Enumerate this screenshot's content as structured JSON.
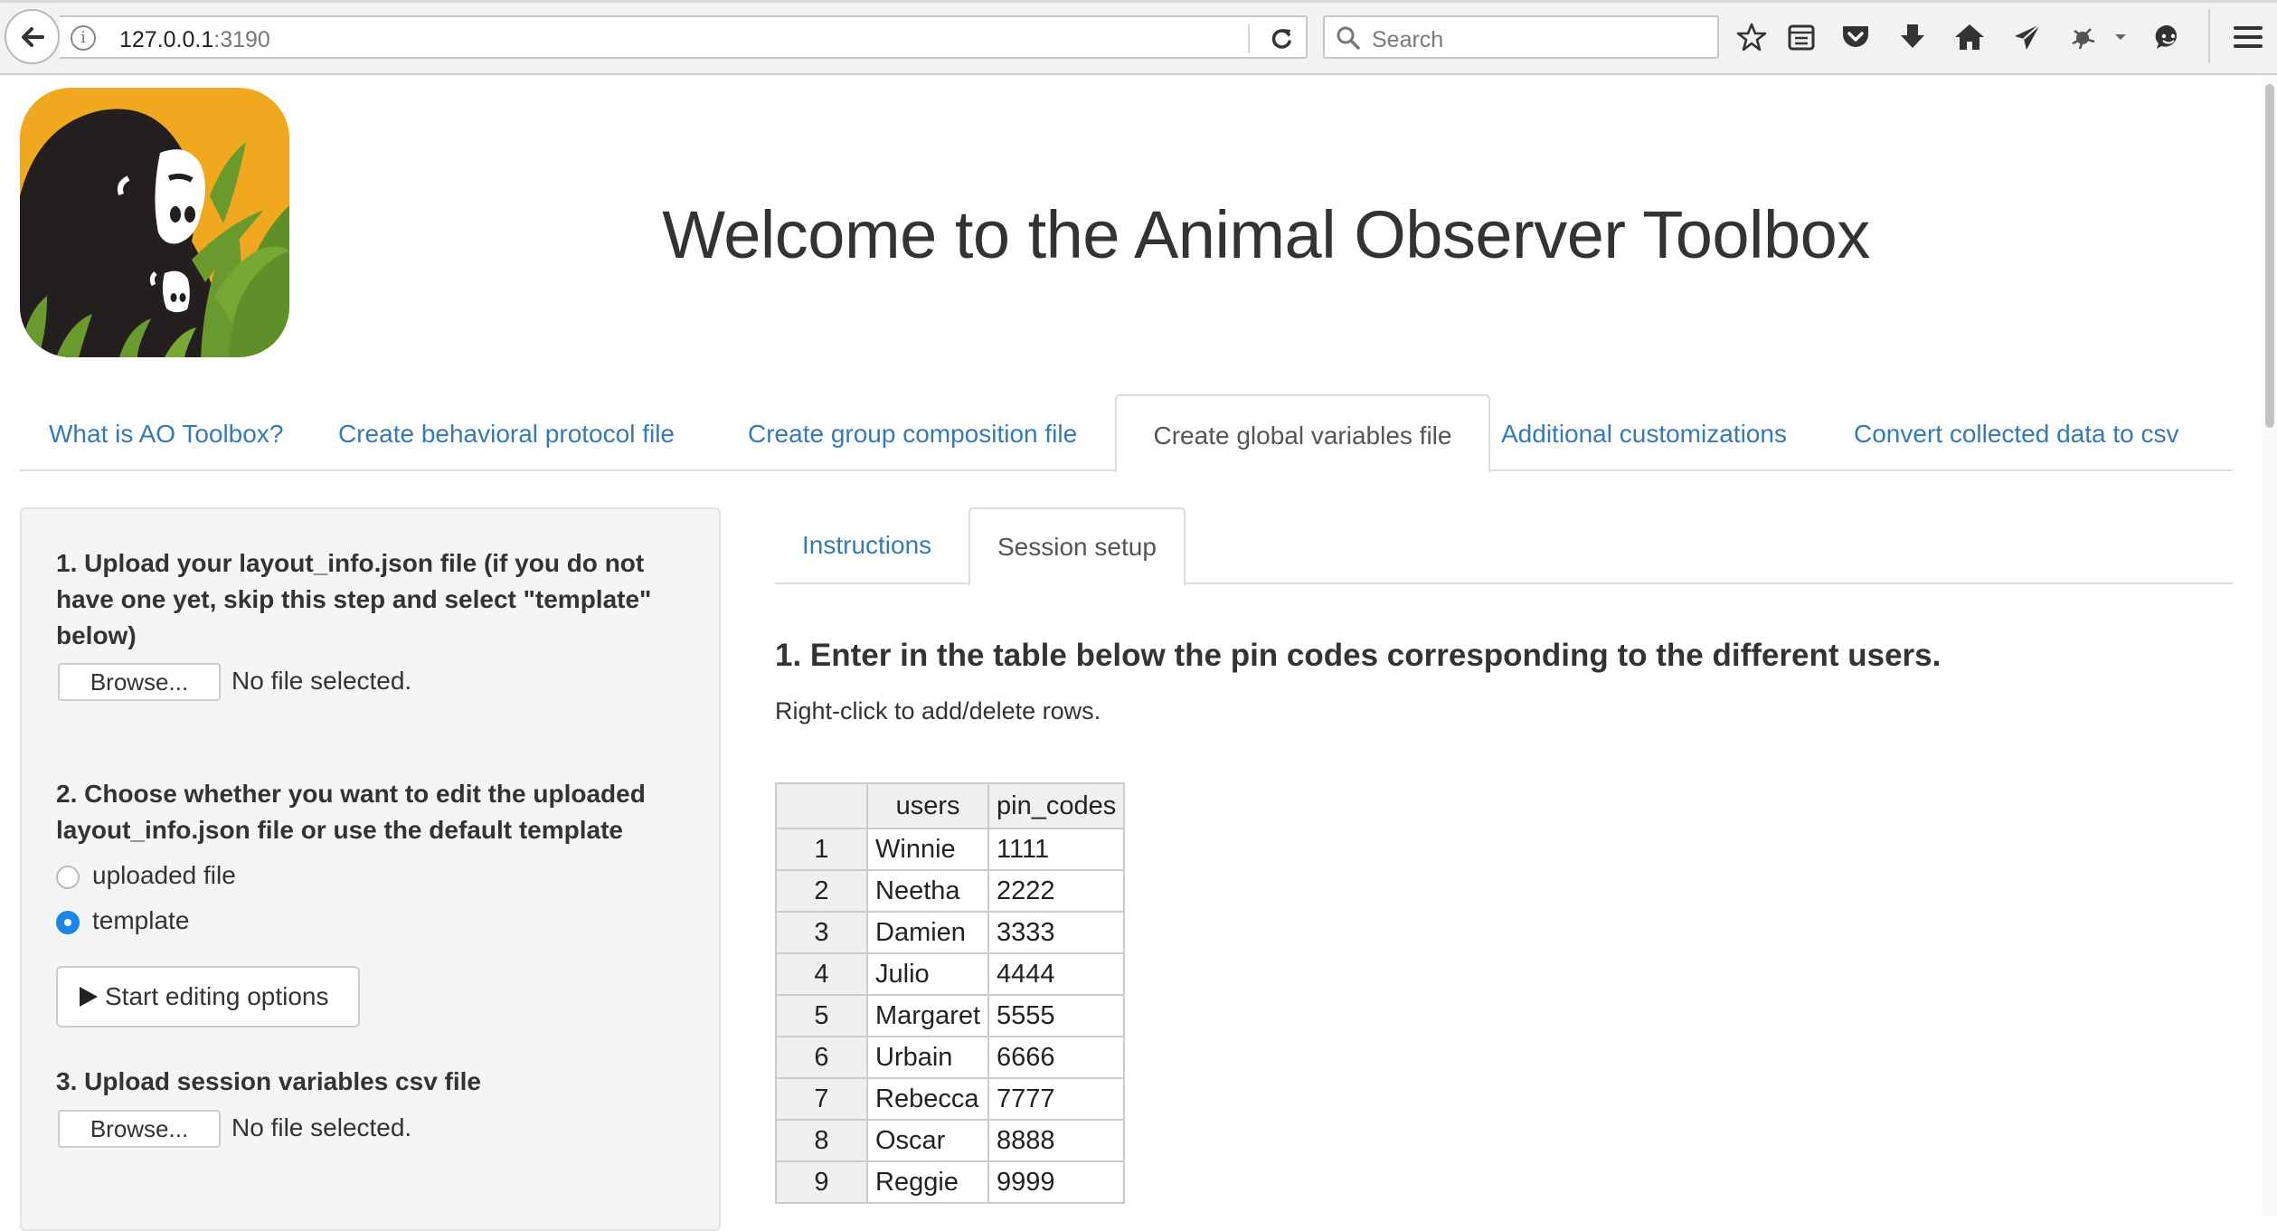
{
  "browser": {
    "url_host": "127.0.0.1",
    "url_port": ":3190",
    "search_placeholder": "Search"
  },
  "header": {
    "title": "Welcome to the Animal Observer Toolbox"
  },
  "main_tabs": [
    {
      "label": "What is AO Toolbox?"
    },
    {
      "label": "Create behavioral protocol file"
    },
    {
      "label": "Create group composition file"
    },
    {
      "label": "Create global variables file"
    },
    {
      "label": "Additional customizations"
    },
    {
      "label": "Convert collected data to csv"
    }
  ],
  "active_main_tab": "Create global variables file",
  "sidebar": {
    "step1_label": "1. Upload your layout_info.json file (if you do not have one yet, skip this step and select \"template\" below)",
    "browse_label": "Browse...",
    "no_file": "No file selected.",
    "step2_label": "2. Choose whether you want to edit the uploaded layout_info.json file or use the default template",
    "radio_options": [
      {
        "label": "uploaded file",
        "checked": false
      },
      {
        "label": "template",
        "checked": true
      }
    ],
    "start_editing_label": "Start editing options",
    "step3_label": "3. Upload session variables csv file"
  },
  "sub_tabs": [
    {
      "label": "Instructions"
    },
    {
      "label": "Session setup"
    }
  ],
  "active_sub_tab": "Session setup",
  "content": {
    "heading": "1. Enter in the table below the pin codes corresponding to the different users.",
    "subtext": "Right-click to add/delete rows.",
    "table": {
      "columns": [
        "users",
        "pin_codes"
      ],
      "rows": [
        {
          "n": "1",
          "user": "Winnie",
          "pin": "1111"
        },
        {
          "n": "2",
          "user": "Neetha",
          "pin": "2222"
        },
        {
          "n": "3",
          "user": "Damien",
          "pin": "3333"
        },
        {
          "n": "4",
          "user": "Julio",
          "pin": "4444"
        },
        {
          "n": "5",
          "user": "Margaret",
          "pin": "5555"
        },
        {
          "n": "6",
          "user": "Urbain",
          "pin": "6666"
        },
        {
          "n": "7",
          "user": "Rebecca",
          "pin": "7777"
        },
        {
          "n": "8",
          "user": "Oscar",
          "pin": "8888"
        },
        {
          "n": "9",
          "user": "Reggie",
          "pin": "9999"
        }
      ]
    }
  },
  "colors": {
    "link": "#337ab7",
    "logo_bg": "#f0a81f",
    "logo_leaf": "#6a9a2e",
    "radio_checked": "#1a86e8"
  }
}
